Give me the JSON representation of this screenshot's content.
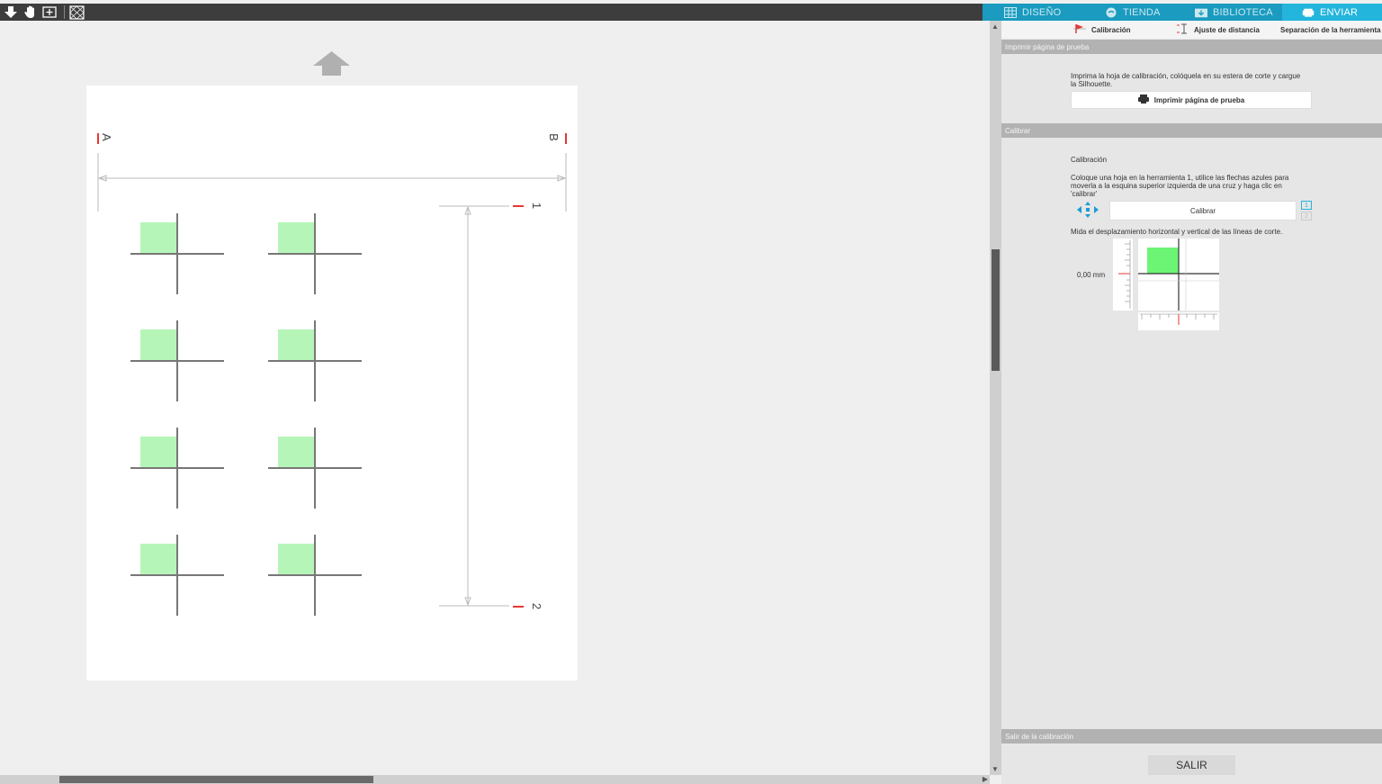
{
  "toolbar": {
    "icons": [
      "send-down-icon",
      "pan-hand-icon",
      "add-page-icon",
      "registration-icon"
    ]
  },
  "tabs": [
    {
      "label": "DISEÑO",
      "icon": "grid-icon"
    },
    {
      "label": "TIENDA",
      "icon": "store-icon"
    },
    {
      "label": "BIBLIOTECA",
      "icon": "library-icon"
    },
    {
      "label": "ENVIAR",
      "icon": "send-icon",
      "active": true
    }
  ],
  "subtabs": [
    {
      "label": "Calibración",
      "icon": "calibration-pin-icon",
      "active": true
    },
    {
      "label": "Ajuste de distancia",
      "icon": "distance-icon"
    },
    {
      "label": "Separación de la herramienta",
      "icon": ""
    }
  ],
  "canvas": {
    "mark_a": "A",
    "mark_b": "B",
    "mark_1": "1",
    "mark_2": "2"
  },
  "panel": {
    "print_section": {
      "header": "Imprimir página de prueba",
      "instructions": "Imprima la hoja de calibración, colóquela en su estera de corte y cargue la Silhouette.",
      "button_label": "Imprimir página de prueba"
    },
    "calibrate_section": {
      "header": "Calibrar",
      "title": "Calibración",
      "instructions": "Coloque una hoja en la herramienta 1, utilice las flechas azules para moverla a la esquina superior izquierda de una cruz y haga clic en 'calibrar'",
      "button_label": "Calibrar",
      "tool_1": "1",
      "tool_2": "2",
      "measure_text": "Mida el desplazamiento horizontal y vertical de las líneas de corte.",
      "vertical_offset": "0,00 mm"
    },
    "exit_section": {
      "header": "Salir de la calibración",
      "button_label": "SALIR"
    }
  },
  "colors": {
    "accent": "#23b5dc",
    "green_square": "#b6f5b8",
    "red_mark": "#e53935"
  }
}
